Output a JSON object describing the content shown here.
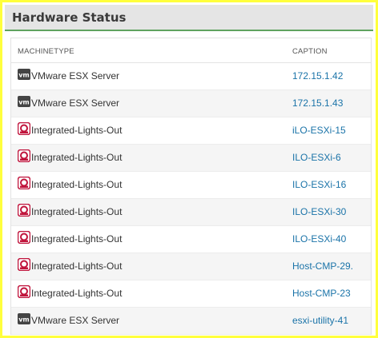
{
  "panel": {
    "title": "Hardware Status"
  },
  "table": {
    "headers": {
      "machinetype": "MACHINETYPE",
      "caption": "CAPTION"
    },
    "rows": [
      {
        "machinetype": "VMware ESX Server",
        "caption": "172.15.1.42",
        "icon": "vmware-icon"
      },
      {
        "machinetype": "VMware ESX Server",
        "caption": "172.15.1.43",
        "icon": "vmware-icon"
      },
      {
        "machinetype": "Integrated-Lights-Out",
        "caption": "iLO-ESXi-15",
        "icon": "ilo-icon"
      },
      {
        "machinetype": "Integrated-Lights-Out",
        "caption": "ILO-ESXi-6",
        "icon": "ilo-icon"
      },
      {
        "machinetype": "Integrated-Lights-Out",
        "caption": "ILO-ESXi-16",
        "icon": "ilo-icon"
      },
      {
        "machinetype": "Integrated-Lights-Out",
        "caption": "ILO-ESXi-30",
        "icon": "ilo-icon"
      },
      {
        "machinetype": "Integrated-Lights-Out",
        "caption": "ILO-ESXi-40",
        "icon": "ilo-icon"
      },
      {
        "machinetype": "Integrated-Lights-Out",
        "caption": "Host-CMP-29.",
        "icon": "ilo-icon"
      },
      {
        "machinetype": "Integrated-Lights-Out",
        "caption": "Host-CMP-23",
        "icon": "ilo-icon"
      },
      {
        "machinetype": "VMware ESX Server",
        "caption": "esxi-utility-41",
        "icon": "vmware-icon"
      }
    ]
  },
  "colors": {
    "link": "#1a73a8",
    "header_rule": "#5fa35f",
    "ilo": "#c0143c",
    "vmware": "#444444"
  }
}
